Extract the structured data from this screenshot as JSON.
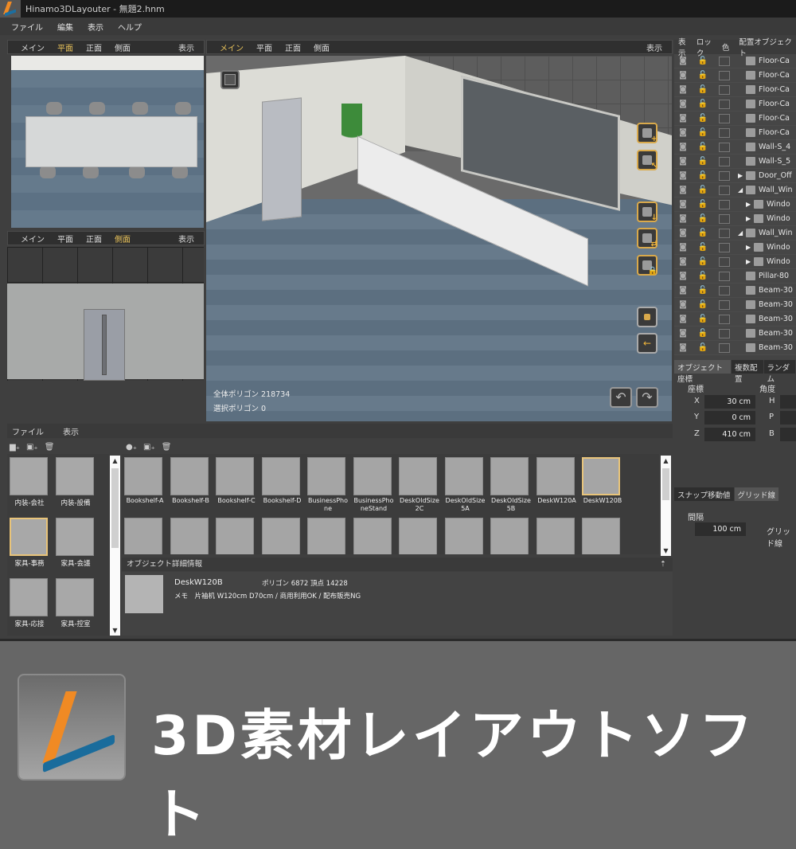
{
  "window": {
    "title": "Hinamo3DLayouter - 無題2.hnm"
  },
  "menu": [
    "ファイル",
    "編集",
    "表示",
    "ヘルプ"
  ],
  "viewports": {
    "top_left": {
      "tabs": [
        "メイン",
        "平面",
        "正面",
        "側面"
      ],
      "active": "平面",
      "display": "表示"
    },
    "bottom_left": {
      "tabs": [
        "メイン",
        "平面",
        "正面",
        "側面"
      ],
      "active": "側面",
      "display": "表示"
    },
    "main": {
      "tabs": [
        "メイン",
        "平面",
        "正面",
        "側面"
      ],
      "active": "メイン",
      "display": "表示",
      "total_polygons_label": "全体ポリゴン",
      "total_polygons": "218734",
      "selected_polygons_label": "選択ポリゴン",
      "selected_polygons": "0"
    }
  },
  "toolbar_icons": [
    "add-object-icon",
    "select-object-icon",
    "drop-to-floor-icon",
    "align-objects-icon",
    "rotation-lock-icon",
    "local-axis-icon",
    "world-axis-icon",
    "undo-icon",
    "redo-icon"
  ],
  "object_list": {
    "headers": [
      "表示",
      "ロック",
      "色",
      "配置オブジェクト"
    ],
    "rows": [
      {
        "name": "Floor-Ca",
        "arrow": "",
        "indent": 0
      },
      {
        "name": "Floor-Ca",
        "arrow": "",
        "indent": 0
      },
      {
        "name": "Floor-Ca",
        "arrow": "",
        "indent": 0
      },
      {
        "name": "Floor-Ca",
        "arrow": "",
        "indent": 0
      },
      {
        "name": "Floor-Ca",
        "arrow": "",
        "indent": 0
      },
      {
        "name": "Floor-Ca",
        "arrow": "",
        "indent": 0
      },
      {
        "name": "Wall-S_4",
        "arrow": "",
        "indent": 0
      },
      {
        "name": "Wall-S_5",
        "arrow": "",
        "indent": 0
      },
      {
        "name": "Door_Off",
        "arrow": "▶",
        "indent": 0
      },
      {
        "name": "Wall_Win",
        "arrow": "◢",
        "indent": 0
      },
      {
        "name": "Windo",
        "arrow": "▶",
        "indent": 1
      },
      {
        "name": "Windo",
        "arrow": "▶",
        "indent": 1
      },
      {
        "name": "Wall_Win",
        "arrow": "◢",
        "indent": 0
      },
      {
        "name": "Windo",
        "arrow": "▶",
        "indent": 1
      },
      {
        "name": "Windo",
        "arrow": "▶",
        "indent": 1
      },
      {
        "name": "Pillar-80",
        "arrow": "",
        "indent": 0
      },
      {
        "name": "Beam-30",
        "arrow": "",
        "indent": 0
      },
      {
        "name": "Beam-30",
        "arrow": "",
        "indent": 0
      },
      {
        "name": "Beam-30",
        "arrow": "",
        "indent": 0
      },
      {
        "name": "Beam-30",
        "arrow": "",
        "indent": 0
      },
      {
        "name": "Beam-30",
        "arrow": "",
        "indent": 0
      }
    ]
  },
  "coords": {
    "tabs": [
      "オブジェクト座標",
      "複数配置",
      "ランダム"
    ],
    "position_label": "座標",
    "angle_label": "角度",
    "x_label": "X",
    "x": "30 cm",
    "y_label": "Y",
    "y": "0 cm",
    "z_label": "Z",
    "z": "410 cm",
    "h_label": "H",
    "p_label": "P",
    "b_label": "B"
  },
  "snap": {
    "tabs": [
      "スナップ移動値",
      "グリッド線"
    ],
    "interval_label": "間隔",
    "interval": "100 cm",
    "grid_label": "グリッド線"
  },
  "library": {
    "tabs": [
      "ファイル",
      "表示"
    ],
    "categories": [
      {
        "label": "内装-会社",
        "selected": false
      },
      {
        "label": "内装-設備",
        "selected": false
      },
      {
        "label": "家具-事務",
        "selected": true
      },
      {
        "label": "家具-会議",
        "selected": false
      },
      {
        "label": "家具-応接",
        "selected": false
      },
      {
        "label": "家具-控室",
        "selected": false
      }
    ],
    "items": [
      {
        "label": "Bookshelf-A",
        "selected": false
      },
      {
        "label": "Bookshelf-B",
        "selected": false
      },
      {
        "label": "Bookshelf-C",
        "selected": false
      },
      {
        "label": "Bookshelf-D",
        "selected": false
      },
      {
        "label": "BusinessPhone",
        "selected": false
      },
      {
        "label": "BusinessPhoneStand",
        "selected": false
      },
      {
        "label": "DeskOldSize2C",
        "selected": false
      },
      {
        "label": "DeskOldSize5A",
        "selected": false
      },
      {
        "label": "DeskOldSize5B",
        "selected": false
      },
      {
        "label": "DeskW120A",
        "selected": false
      },
      {
        "label": "DeskW120B",
        "selected": true
      }
    ],
    "second_row_count": 11
  },
  "detail": {
    "header": "オブジェクト詳細情報",
    "name": "DeskW120B",
    "polygons": "ポリゴン 6872  頂点 14228",
    "memo": "メモ　片袖机 W120cm D70cm / 商用利用OK / 配布販売NG"
  },
  "banner": {
    "text": "3D素材レイアウトソフト"
  },
  "colors": {
    "accent": "#e8c25a",
    "selection": "#e8c47a",
    "logo_orange": "#f08a24",
    "logo_blue": "#1c6fa0"
  }
}
